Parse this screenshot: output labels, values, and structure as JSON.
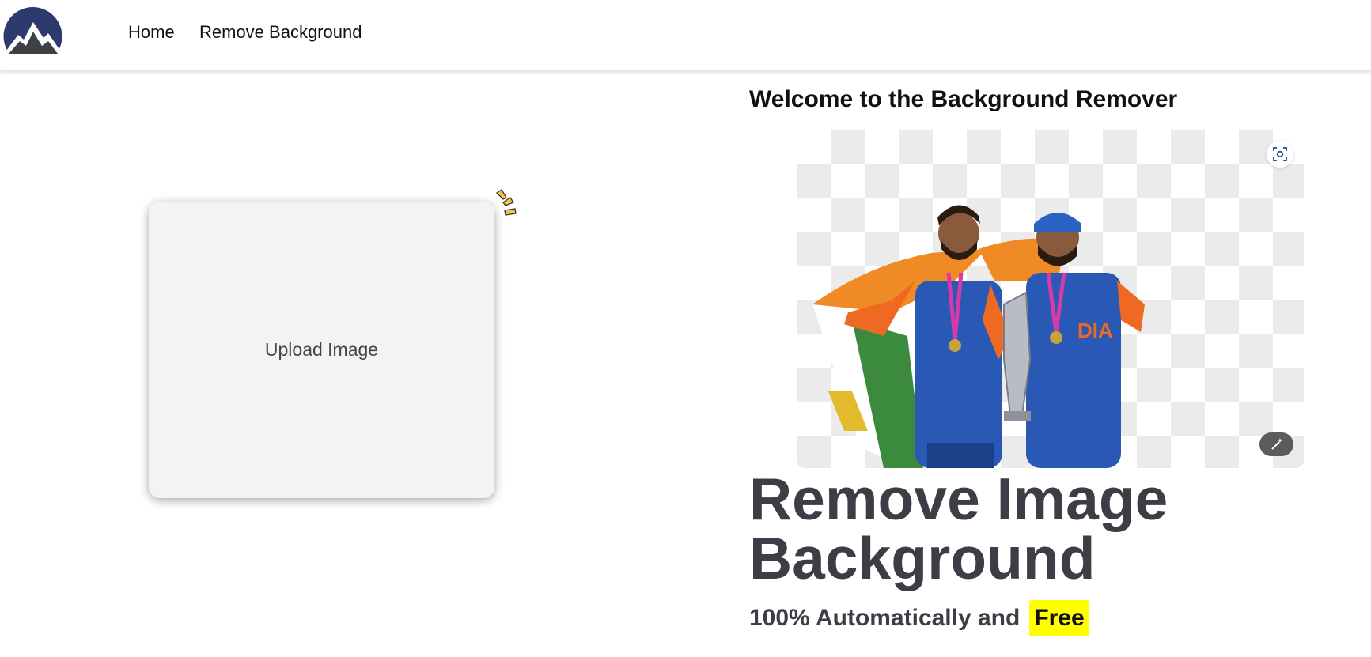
{
  "nav": {
    "logo_icon": "mountain-logo-icon",
    "links": [
      "Home",
      "Remove Background"
    ]
  },
  "upload": {
    "label": "Upload Image"
  },
  "preview": {
    "heading": "Welcome to the Background Remover",
    "image_description_icon": "cricketers-trophy-photo",
    "scan_icon": "scan-focus-icon",
    "magic_icon": "magic-wand-icon"
  },
  "hero": {
    "title": "Remove Image Background",
    "subtitle": "100% Automatically and",
    "highlight": "Free"
  },
  "colors": {
    "accent_yellow": "#ffff00",
    "heading_dark": "#3d3d45",
    "logo_navy": "#2d3a6e"
  }
}
